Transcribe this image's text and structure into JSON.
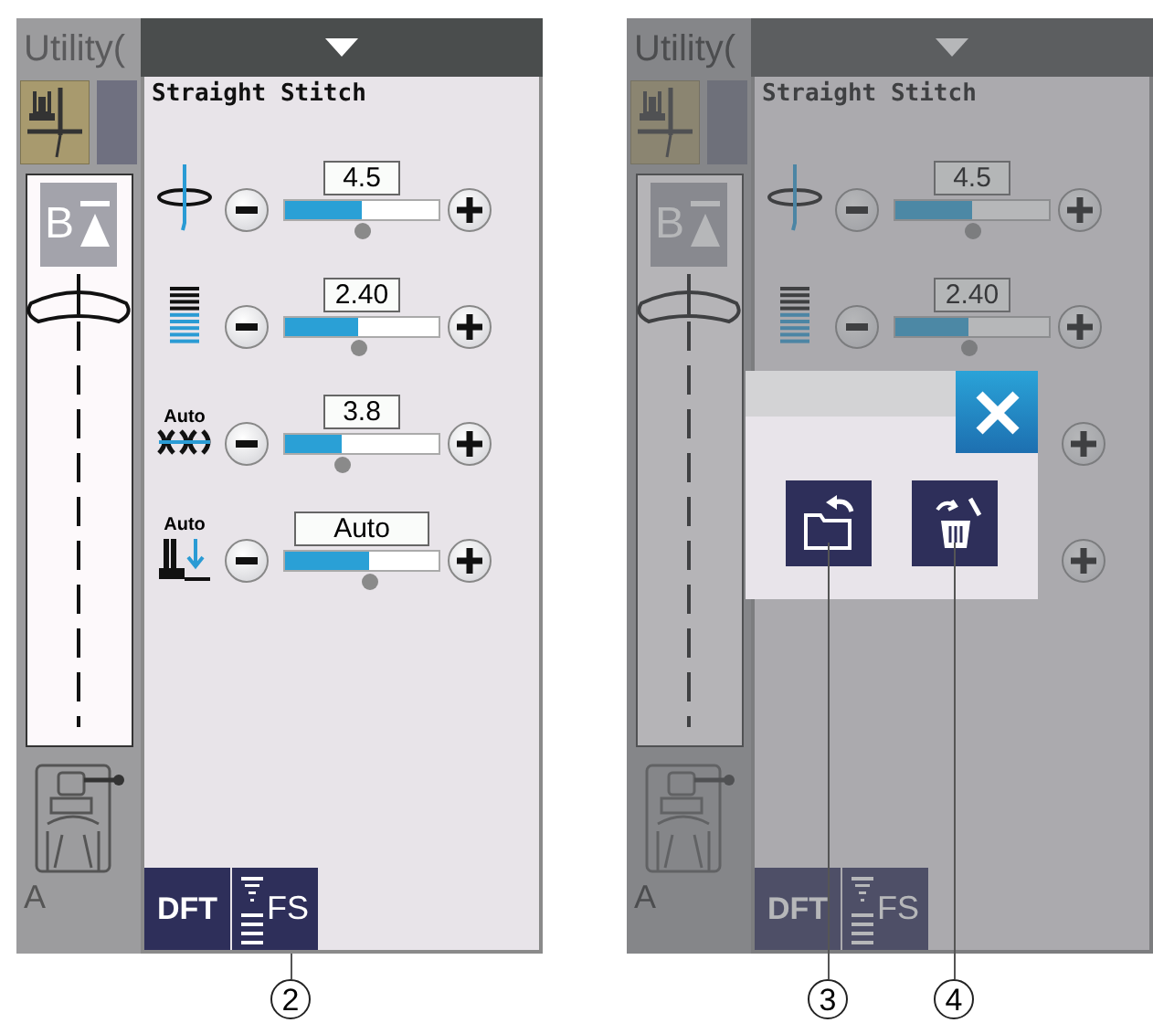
{
  "screens": [
    {
      "category_tab": "Utility(",
      "pattern_name": "Straight Stitch",
      "pattern_letter": "B",
      "dimmed": false,
      "foot_letter": "A",
      "settings": [
        {
          "kind": "width",
          "value": "4.5",
          "level": 0.5
        },
        {
          "kind": "length",
          "value": "2.40",
          "level": 0.48
        },
        {
          "kind": "tension",
          "icon_label": "Auto",
          "value": "3.8",
          "level": 0.37
        },
        {
          "kind": "pressure",
          "icon_label": "Auto",
          "value": "Auto",
          "level": 0.55
        }
      ],
      "buttons": [
        {
          "kind": "dft",
          "label": "DFT"
        },
        {
          "kind": "fs",
          "label": "FS",
          "callout": "2"
        }
      ]
    },
    {
      "category_tab": "Utility(",
      "pattern_name": "Straight Stitch",
      "pattern_letter": "B",
      "dimmed": true,
      "foot_letter": "A",
      "settings": [
        {
          "kind": "width",
          "value": "4.5",
          "level": 0.5
        },
        {
          "kind": "length",
          "value": "2.40",
          "level": 0.48
        },
        {
          "kind": "covered"
        },
        {
          "kind": "covered"
        }
      ],
      "buttons": [
        {
          "kind": "dft",
          "label": "DFT"
        },
        {
          "kind": "fs",
          "label": "FS"
        }
      ],
      "dialog": {
        "buttons": [
          {
            "kind": "recall",
            "callout": "3"
          },
          {
            "kind": "delete",
            "callout": "4"
          }
        ]
      }
    }
  ]
}
